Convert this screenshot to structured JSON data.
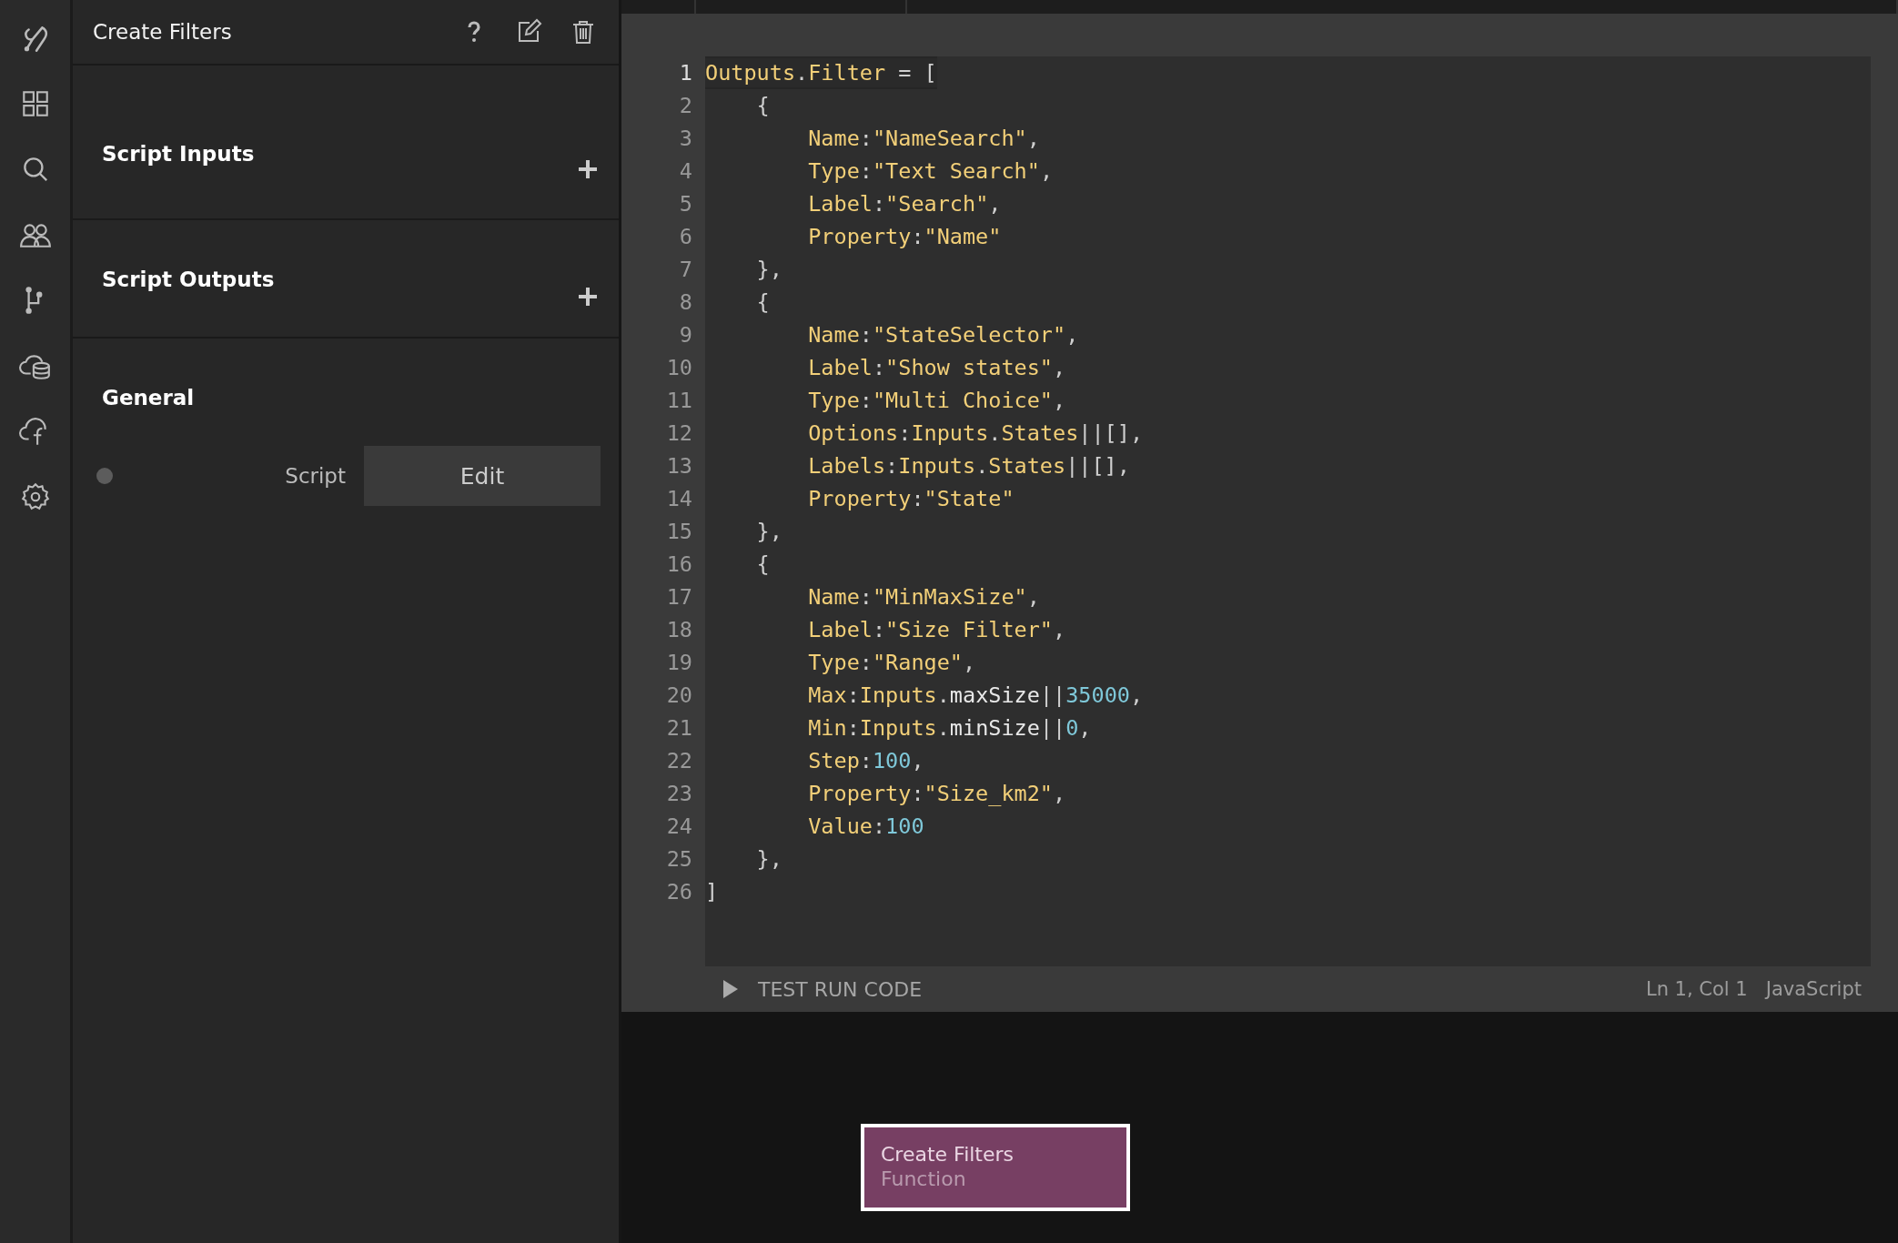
{
  "panel": {
    "title": "Create Filters",
    "sections": [
      {
        "title": "Script Inputs",
        "addable": true
      },
      {
        "title": "Script Outputs",
        "addable": true
      },
      {
        "title": "General",
        "addable": false
      }
    ],
    "field": {
      "label": "Script",
      "button": "Edit"
    }
  },
  "editor": {
    "lines": [
      [
        {
          "kind": "id",
          "text": "Outputs"
        },
        {
          "kind": "p",
          "text": "."
        },
        {
          "kind": "id",
          "text": "Filter"
        },
        {
          "kind": "p",
          "text": " = ["
        }
      ],
      [
        {
          "kind": "p",
          "text": "    {"
        }
      ],
      [
        {
          "kind": "id",
          "text": "        Name"
        },
        {
          "kind": "p",
          "text": ":"
        },
        {
          "kind": "id",
          "text": "\"NameSearch\""
        },
        {
          "kind": "p",
          "text": ","
        }
      ],
      [
        {
          "kind": "id",
          "text": "        Type"
        },
        {
          "kind": "p",
          "text": ":"
        },
        {
          "kind": "id",
          "text": "\"Text Search\""
        },
        {
          "kind": "p",
          "text": ","
        }
      ],
      [
        {
          "kind": "id",
          "text": "        Label"
        },
        {
          "kind": "p",
          "text": ":"
        },
        {
          "kind": "id",
          "text": "\"Search\""
        },
        {
          "kind": "p",
          "text": ","
        }
      ],
      [
        {
          "kind": "id",
          "text": "        Property"
        },
        {
          "kind": "p",
          "text": ":"
        },
        {
          "kind": "id",
          "text": "\"Name\""
        }
      ],
      [
        {
          "kind": "p",
          "text": "    },"
        }
      ],
      [
        {
          "kind": "p",
          "text": "    {"
        }
      ],
      [
        {
          "kind": "id",
          "text": "        Name"
        },
        {
          "kind": "p",
          "text": ":"
        },
        {
          "kind": "id",
          "text": "\"StateSelector\""
        },
        {
          "kind": "p",
          "text": ","
        }
      ],
      [
        {
          "kind": "id",
          "text": "        Label"
        },
        {
          "kind": "p",
          "text": ":"
        },
        {
          "kind": "id",
          "text": "\"Show states\""
        },
        {
          "kind": "p",
          "text": ","
        }
      ],
      [
        {
          "kind": "id",
          "text": "        Type"
        },
        {
          "kind": "p",
          "text": ":"
        },
        {
          "kind": "id",
          "text": "\"Multi Choice\""
        },
        {
          "kind": "p",
          "text": ","
        }
      ],
      [
        {
          "kind": "id",
          "text": "        Options"
        },
        {
          "kind": "p",
          "text": ":"
        },
        {
          "kind": "id",
          "text": "Inputs"
        },
        {
          "kind": "p",
          "text": "."
        },
        {
          "kind": "id",
          "text": "States"
        },
        {
          "kind": "p",
          "text": "||[],"
        }
      ],
      [
        {
          "kind": "id",
          "text": "        Labels"
        },
        {
          "kind": "p",
          "text": ":"
        },
        {
          "kind": "id",
          "text": "Inputs"
        },
        {
          "kind": "p",
          "text": "."
        },
        {
          "kind": "id",
          "text": "States"
        },
        {
          "kind": "p",
          "text": "||[],"
        }
      ],
      [
        {
          "kind": "id",
          "text": "        Property"
        },
        {
          "kind": "p",
          "text": ":"
        },
        {
          "kind": "id",
          "text": "\"State\""
        }
      ],
      [
        {
          "kind": "p",
          "text": "    },"
        }
      ],
      [
        {
          "kind": "p",
          "text": "    {"
        }
      ],
      [
        {
          "kind": "id",
          "text": "        Name"
        },
        {
          "kind": "p",
          "text": ":"
        },
        {
          "kind": "id",
          "text": "\"MinMaxSize\""
        },
        {
          "kind": "p",
          "text": ","
        }
      ],
      [
        {
          "kind": "id",
          "text": "        Label"
        },
        {
          "kind": "p",
          "text": ":"
        },
        {
          "kind": "id",
          "text": "\"Size Filter\""
        },
        {
          "kind": "p",
          "text": ","
        }
      ],
      [
        {
          "kind": "id",
          "text": "        Type"
        },
        {
          "kind": "p",
          "text": ":"
        },
        {
          "kind": "id",
          "text": "\"Range\""
        },
        {
          "kind": "p",
          "text": ","
        }
      ],
      [
        {
          "kind": "id",
          "text": "        Max"
        },
        {
          "kind": "p",
          "text": ":"
        },
        {
          "kind": "id",
          "text": "Inputs"
        },
        {
          "kind": "p",
          "text": "."
        },
        {
          "kind": "w",
          "text": "maxSize"
        },
        {
          "kind": "p",
          "text": "||"
        },
        {
          "kind": "n",
          "text": "35000"
        },
        {
          "kind": "p",
          "text": ","
        }
      ],
      [
        {
          "kind": "id",
          "text": "        Min"
        },
        {
          "kind": "p",
          "text": ":"
        },
        {
          "kind": "id",
          "text": "Inputs"
        },
        {
          "kind": "p",
          "text": "."
        },
        {
          "kind": "w",
          "text": "minSize"
        },
        {
          "kind": "p",
          "text": "||"
        },
        {
          "kind": "n",
          "text": "0"
        },
        {
          "kind": "p",
          "text": ","
        }
      ],
      [
        {
          "kind": "id",
          "text": "        Step"
        },
        {
          "kind": "p",
          "text": ":"
        },
        {
          "kind": "n",
          "text": "100"
        },
        {
          "kind": "p",
          "text": ","
        }
      ],
      [
        {
          "kind": "id",
          "text": "        Property"
        },
        {
          "kind": "p",
          "text": ":"
        },
        {
          "kind": "id",
          "text": "\"Size_km2\""
        },
        {
          "kind": "p",
          "text": ","
        }
      ],
      [
        {
          "kind": "id",
          "text": "        Value"
        },
        {
          "kind": "p",
          "text": ":"
        },
        {
          "kind": "n",
          "text": "100"
        }
      ],
      [
        {
          "kind": "p",
          "text": "    },"
        }
      ],
      [
        {
          "kind": "p",
          "text": "]"
        }
      ]
    ],
    "line_numbers": [
      "1",
      "2",
      "3",
      "4",
      "5",
      "6",
      "7",
      "8",
      "9",
      "10",
      "11",
      "12",
      "13",
      "14",
      "15",
      "16",
      "17",
      "18",
      "19",
      "20",
      "21",
      "22",
      "23",
      "24",
      "25",
      "26"
    ],
    "run_button": "TEST RUN CODE",
    "cursor": "Ln 1, Col 1",
    "language": "JavaScript"
  },
  "node": {
    "title": "Create Filters",
    "subtitle": "Function",
    "selected": true
  }
}
